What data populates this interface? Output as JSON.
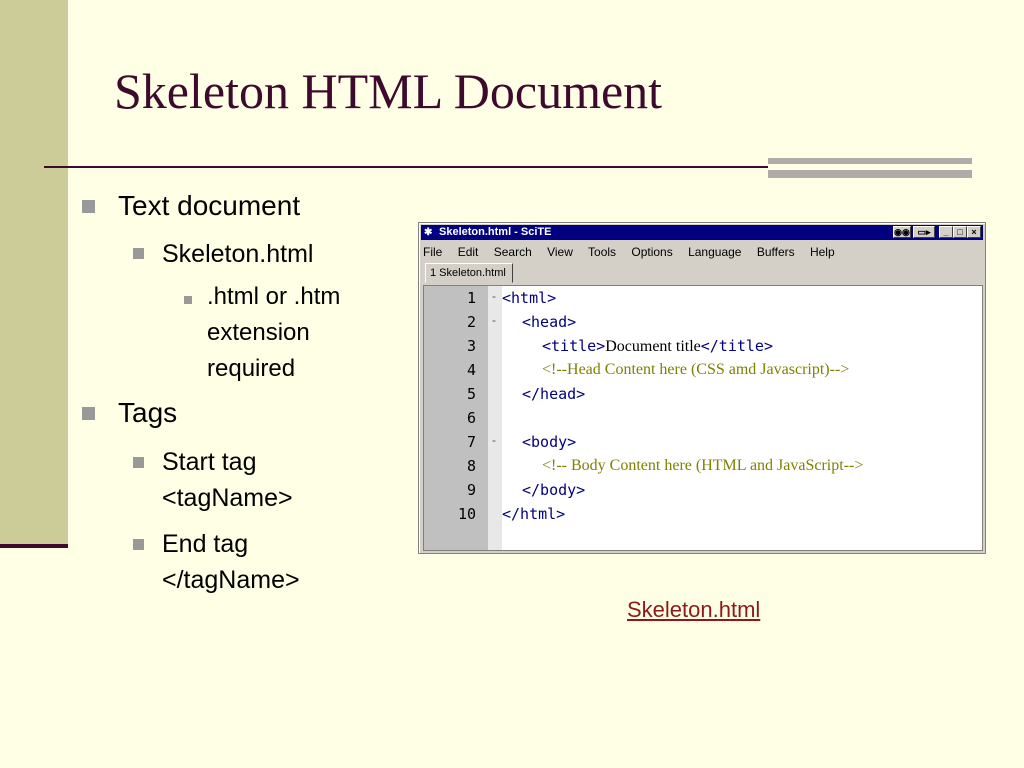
{
  "slide": {
    "title": "Skeleton HTML Document",
    "bullets": [
      {
        "text": "Text document"
      },
      {
        "text": "Skeleton.html"
      },
      {
        "lines": [
          ".html or .htm",
          "extension",
          "required"
        ]
      },
      {
        "text": "Tags"
      },
      {
        "lines": [
          "Start tag",
          "<tagName>"
        ]
      },
      {
        "lines": [
          "End tag",
          "</tagName>"
        ]
      }
    ],
    "link_label": "Skeleton.html"
  },
  "window": {
    "title": "Skeleton.html - SciTE",
    "menu": [
      "File",
      "Edit",
      "Search",
      "View",
      "Tools",
      "Options",
      "Language",
      "Buffers",
      "Help"
    ],
    "tab_label": "1 Skeleton.html",
    "line_numbers": [
      "1",
      "2",
      "3",
      "4",
      "5",
      "6",
      "7",
      "8",
      "9",
      "10"
    ],
    "code": {
      "l1": "<html>",
      "l2": "<head>",
      "l3_open": "<title>",
      "l3_text": "Document title",
      "l3_close": "</title>",
      "l4": "<!--Head Content here (CSS amd Javascript)-->",
      "l5": "</head>",
      "l7": "<body>",
      "l8": "<!-- Body Content here (HTML and JavaScript-->",
      "l9": "</body>",
      "l10": "</html>"
    }
  },
  "colors": {
    "background": "#ffffe5",
    "title": "#3d0a2e",
    "band": "#cccc99",
    "tag": "#000080",
    "comment": "#808000",
    "link": "#8b1a1a"
  }
}
